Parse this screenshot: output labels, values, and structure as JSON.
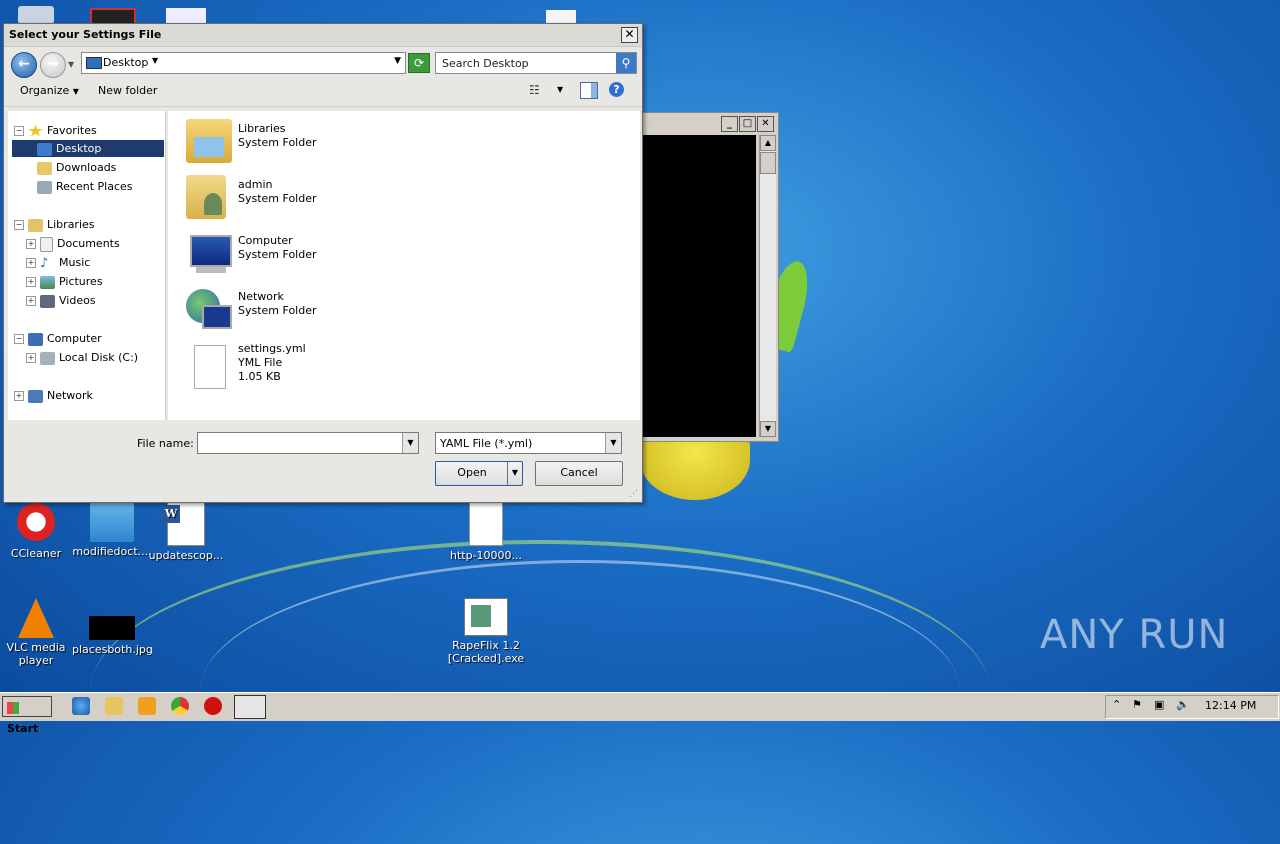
{
  "dialog": {
    "title": "Select your Settings File",
    "address": "Desktop",
    "search_placeholder": "Search Desktop",
    "toolbar": {
      "organize": "Organize",
      "new_folder": "New folder"
    },
    "nav_tree": {
      "favorites": "Favorites",
      "desktop": "Desktop",
      "downloads": "Downloads",
      "recent_places": "Recent Places",
      "libraries": "Libraries",
      "documents": "Documents",
      "music": "Music",
      "pictures": "Pictures",
      "videos": "Videos",
      "computer": "Computer",
      "local_disk": "Local Disk (C:)",
      "network": "Network"
    },
    "files": [
      {
        "name": "Libraries",
        "type": "System Folder",
        "icon": "libraries-icon"
      },
      {
        "name": "admin",
        "type": "System Folder",
        "icon": "user-folder-icon"
      },
      {
        "name": "Computer",
        "type": "System Folder",
        "icon": "computer-icon"
      },
      {
        "name": "Network",
        "type": "System Folder",
        "icon": "network-icon"
      },
      {
        "name": "settings.yml",
        "type": "YML File",
        "size": "1.05 KB",
        "icon": "document-icon"
      }
    ],
    "file_name_label": "File name:",
    "file_name_value": "",
    "file_type": "YAML File (*.yml)",
    "open_label": "Open",
    "cancel_label": "Cancel"
  },
  "desktop_icons": [
    {
      "label": "CCleaner"
    },
    {
      "label": "modifiedoct...."
    },
    {
      "label": "updatescop..."
    },
    {
      "label": "http-10000..."
    },
    {
      "label": "VLC media player"
    },
    {
      "label": "placesboth.jpg"
    },
    {
      "label": "RapeFlix 1.2 [Cracked].exe"
    }
  ],
  "watermark": "ANY RUN",
  "taskbar": {
    "start": "Start",
    "clock": "12:14 PM"
  },
  "colors": {
    "selection": "#1f3b6e",
    "desktop": "#1a6cc4",
    "taskbar": "#d4d0c8"
  }
}
